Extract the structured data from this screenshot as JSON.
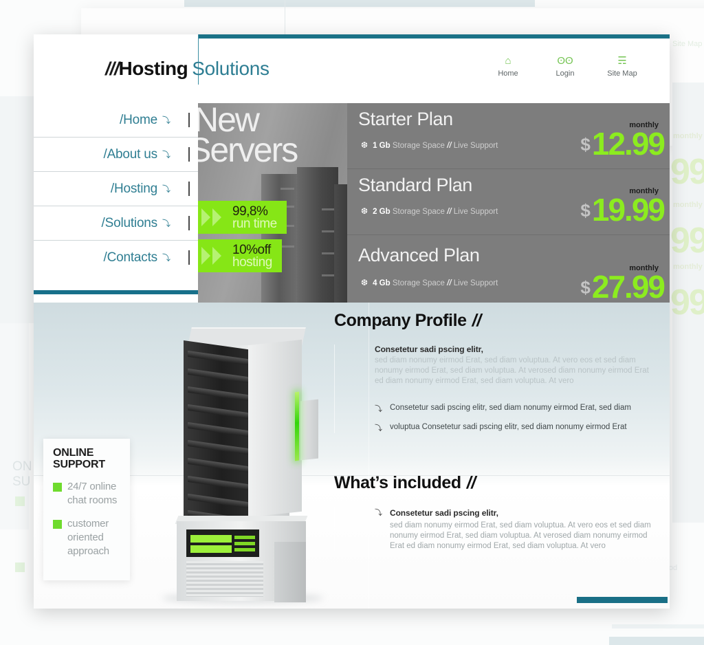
{
  "site": {
    "logo": {
      "slashes": "///",
      "word1": "Hosting",
      "word2": "Solutions"
    }
  },
  "top_utils": [
    {
      "label": "Home",
      "icon": "home-icon",
      "glyph": "⌂"
    },
    {
      "label": "Login",
      "icon": "users-icon",
      "glyph": "ʘʘ"
    },
    {
      "label": "Site Map",
      "icon": "sitemap-icon",
      "glyph": "☴"
    }
  ],
  "sidebar": {
    "items": [
      {
        "label": "/Home",
        "arrow": "⤵"
      },
      {
        "label": "/About us",
        "arrow": "⤵"
      },
      {
        "label": "/Hosting",
        "arrow": "⤵"
      },
      {
        "label": "/Solutions",
        "arrow": "⤵"
      },
      {
        "label": "/Contacts",
        "arrow": "⤵"
      }
    ]
  },
  "hero": {
    "title_line1": "New",
    "title_line2": "Servers",
    "badges": [
      {
        "line1": "99,8%",
        "line2": "run time"
      },
      {
        "line1": "10%off",
        "line2": "hosting"
      }
    ]
  },
  "plans": [
    {
      "name": "Starter Plan",
      "flake": "❆",
      "storage": "1 Gb",
      "feature_rest": "Storage Space",
      "separator": "//",
      "support": "Live Support",
      "period": "monthly",
      "currency": "$",
      "price": "12.99"
    },
    {
      "name": "Standard Plan",
      "flake": "❆",
      "storage": "2 Gb",
      "feature_rest": "Storage Space",
      "separator": "//",
      "support": "Live Support",
      "period": "monthly",
      "currency": "$",
      "price": "19.99"
    },
    {
      "name": "Advanced Plan",
      "flake": "❆",
      "storage": "4 Gb",
      "feature_rest": "Storage Space",
      "separator": "//",
      "support": "Live Support",
      "period": "monthly",
      "currency": "$",
      "price": "27.99"
    }
  ],
  "support_box": {
    "title_line1": "ONLINE",
    "title_line2": "SUPPORT",
    "items": [
      "24/7 online chat rooms",
      "customer oriented approach"
    ]
  },
  "sections": [
    {
      "title": "Company Profile",
      "slashes": "//",
      "lead_heading": "Consetetur sadi pscing elitr,",
      "lead_body": "sed diam nonumy eirmod Erat, sed diam voluptua. At vero eos et sed diam nonumy eirmod Erat, sed diam voluptua. At verosed diam nonumy eirmod Erat ed diam nonumy eirmod Erat, sed diam voluptua. At vero",
      "bullets": [
        {
          "arrow": "⤵",
          "text": "Consetetur sadi pscing elitr, sed diam nonumy eirmod Erat, sed diam"
        },
        {
          "arrow": "⤵",
          "text": "voluptua Consetetur sadi pscing elitr, sed diam nonumy eirmod Erat"
        }
      ]
    },
    {
      "title": "What’s included",
      "slashes": "//",
      "bullet_arrow": "⤵",
      "lead_heading": "Consetetur sadi pscing elitr,",
      "lead_body": "sed diam nonumy eirmod Erat, sed diam voluptua. At vero eos et sed diam nonumy eirmod Erat, sed diam voluptua. At verosed diam nonumy eirmod Erat ed diam nonumy eirmod Erat, sed diam voluptua. At vero"
    }
  ],
  "background_ghost": {
    "site_map": "Site Map",
    "support_line1": "ON",
    "support_line2": "SU",
    "prices": [
      {
        "period": "monthly",
        "digits": "99"
      },
      {
        "period": "monthly",
        "digits": "99"
      },
      {
        "period": "monthly",
        "digits": "99"
      }
    ],
    "word": "rmod"
  },
  "colors": {
    "teal": "#1a7186",
    "green": "#86e616",
    "price_green": "#8cec1f",
    "panel_gray": "#7d7d7d",
    "link_teal": "#2f7e92"
  }
}
